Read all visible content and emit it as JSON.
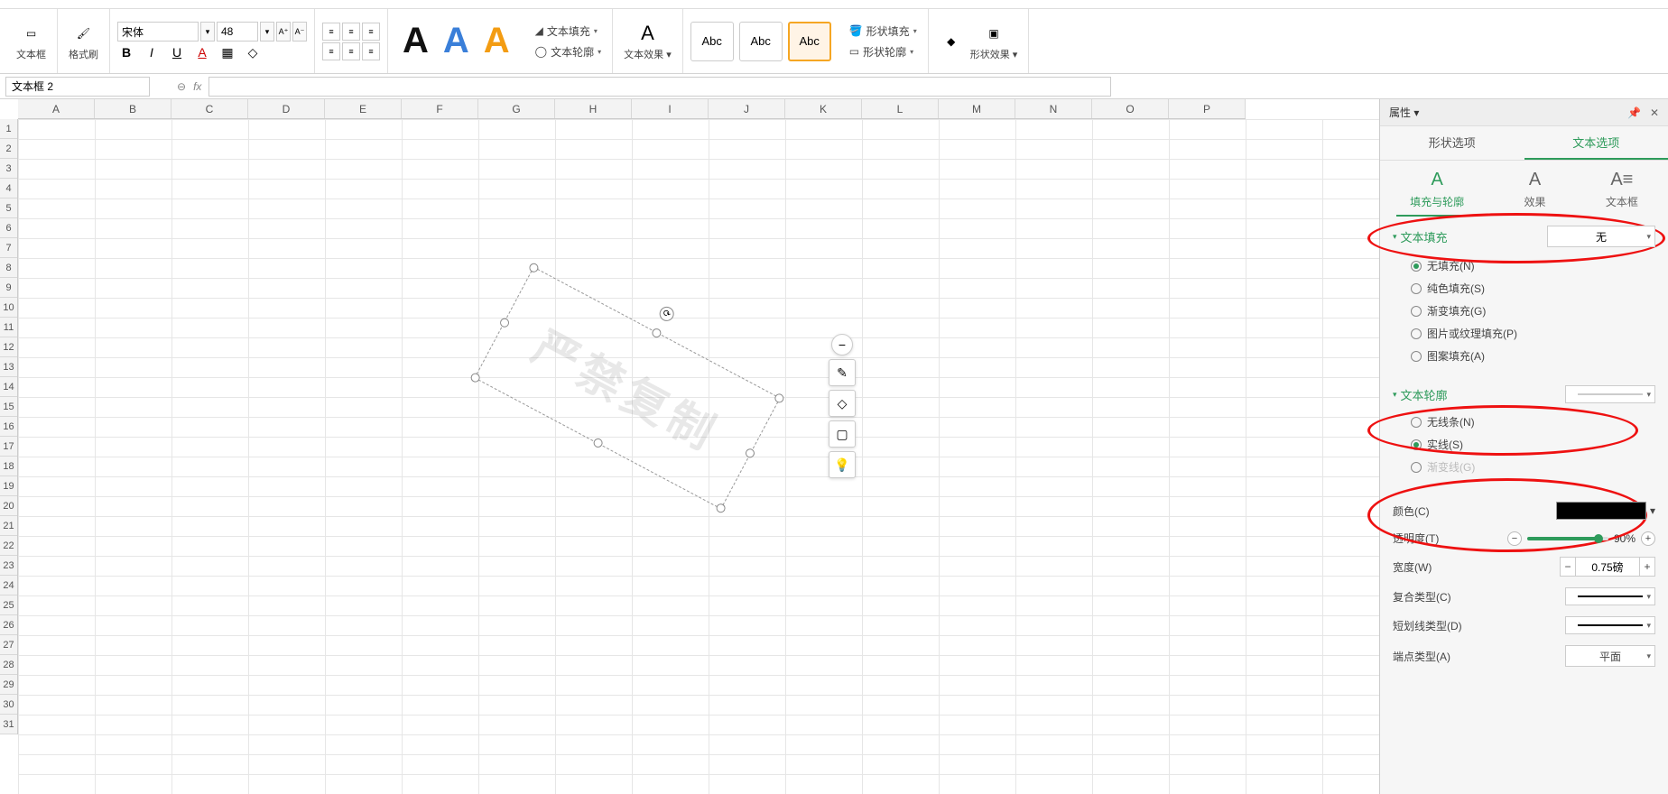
{
  "ribbon": {
    "textbox_label": "文本框",
    "format_brush": "格式刷",
    "font_name": "宋体",
    "font_size": "48",
    "text_fill": "文本填充",
    "text_outline": "文本轮廓",
    "text_effect": "文本效果",
    "abc": "Abc",
    "shape_fill": "形状填充",
    "shape_outline": "形状轮廓",
    "shape_effect": "形状效果"
  },
  "namebox": "文本框 2",
  "columns": [
    "A",
    "B",
    "C",
    "D",
    "E",
    "F",
    "G",
    "H",
    "I",
    "J",
    "K",
    "L",
    "M",
    "N",
    "O",
    "P"
  ],
  "rows": [
    "1",
    "2",
    "3",
    "4",
    "5",
    "6",
    "7",
    "8",
    "9",
    "10",
    "11",
    "12",
    "13",
    "14",
    "15",
    "16",
    "17",
    "18",
    "19",
    "20",
    "21",
    "22",
    "23",
    "24",
    "25",
    "26",
    "27",
    "28",
    "29",
    "30",
    "31"
  ],
  "watermark": "严禁复制",
  "panel": {
    "title": "属性",
    "tab_shape": "形状选项",
    "tab_text": "文本选项",
    "sub_fill": "填充与轮廓",
    "sub_effect": "效果",
    "sub_textbox": "文本框",
    "sec_fill": "文本填充",
    "fill_none_sel": "无",
    "fill_none": "无填充(N)",
    "fill_solid": "纯色填充(S)",
    "fill_gradient": "渐变填充(G)",
    "fill_picture": "图片或纹理填充(P)",
    "fill_pattern": "图案填充(A)",
    "sec_outline": "文本轮廓",
    "outline_none": "无线条(N)",
    "outline_solid": "实线(S)",
    "outline_gradient": "渐变线(G)",
    "color_label": "颜色(C)",
    "trans_label": "透明度(T)",
    "trans_value": "90%",
    "width_label": "宽度(W)",
    "width_value": "0.75磅",
    "compound_label": "复合类型(C)",
    "dash_label": "短划线类型(D)",
    "cap_label": "端点类型(A)",
    "cap_value": "平面"
  }
}
